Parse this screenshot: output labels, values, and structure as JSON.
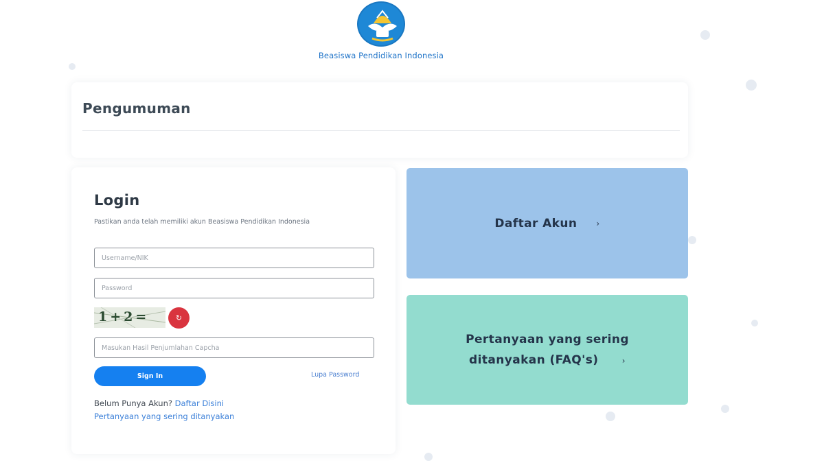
{
  "brand": {
    "name": "Beasiswa Pendidikan Indonesia",
    "logo_icon": "tut-wuri-handayani-logo"
  },
  "announcement": {
    "title": "Pengumuman"
  },
  "login": {
    "title": "Login",
    "subtitle": "Pastikan anda telah memiliki akun Beasiswa Pendidikan Indonesia",
    "username_placeholder": "Username/NIK",
    "password_placeholder": "Password",
    "captcha_text": "1+2=",
    "refresh_icon": "refresh-icon",
    "captcha_placeholder": "Masukan Hasil Penjumlahan Capcha",
    "signin_label": "Sign In",
    "forgot_label": "Lupa Password",
    "no_account_text": "Belum Punya Akun?",
    "register_link": "Daftar Disini",
    "faq_link": "Pertanyaan yang sering ditanyakan"
  },
  "cards": {
    "register_label": "Daftar Akun",
    "faq_line1": "Pertanyaan yang sering",
    "faq_line2": "ditanyakan (FAQ's)",
    "chevron": "›"
  },
  "colors": {
    "primary": "#1580f0",
    "register_card": "#9cc3ea",
    "faq_card": "#93dccf",
    "refresh": "#d9343f",
    "brand_text": "#1e73c8"
  }
}
